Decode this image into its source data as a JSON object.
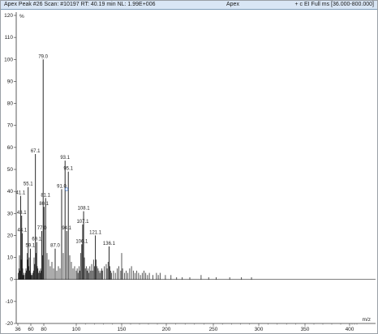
{
  "header": {
    "left_text": "Apex Peak #26 Scan: #10197  RT: 40.19 min NL: 1.99E+006",
    "center_text": "Apex",
    "right_text": "+ c EI Full ms [36.000-800.000]"
  },
  "chart_data": {
    "type": "bar",
    "title": "",
    "xlabel": "m/z",
    "ylabel": "%",
    "xlim": [
      36,
      440
    ],
    "ylim": [
      -20,
      120
    ],
    "x_ticks": [
      "36",
      "60",
      "80",
      "100",
      "150",
      "200",
      "250",
      "300",
      "350",
      "400"
    ],
    "y_ticks": [
      "-20",
      "-10",
      "0",
      "10",
      "20",
      "30",
      "40",
      "50",
      "60",
      "70",
      "80",
      "90",
      "100",
      "110",
      "120"
    ],
    "grid": false,
    "labeled_peaks": [
      {
        "mz": 41.1,
        "intensity": 38,
        "label": "41.1"
      },
      {
        "mz": 43.1,
        "intensity": 29,
        "label": "43.1"
      },
      {
        "mz": 44.1,
        "intensity": 21,
        "label": "44.1"
      },
      {
        "mz": 55.1,
        "intensity": 42,
        "label": "55.1"
      },
      {
        "mz": 59.1,
        "intensity": 14,
        "label": "59.1"
      },
      {
        "mz": 67.1,
        "intensity": 57,
        "label": "67.1"
      },
      {
        "mz": 69.1,
        "intensity": 17,
        "label": "69.1"
      },
      {
        "mz": 77.0,
        "intensity": 22,
        "label": "77.0"
      },
      {
        "mz": 79.0,
        "intensity": 100,
        "label": "79.0"
      },
      {
        "mz": 81.1,
        "intensity": 37,
        "label": "81.1"
      },
      {
        "mz": 80.1,
        "intensity": 33,
        "label": "80.1"
      },
      {
        "mz": 87.0,
        "intensity": 14,
        "label": "87.0"
      },
      {
        "mz": 91.0,
        "intensity": 41,
        "label": "91.0"
      },
      {
        "mz": 93.1,
        "intensity": 54,
        "label": "93.1"
      },
      {
        "mz": 95.1,
        "intensity": 49,
        "label": "95.1"
      },
      {
        "mz": 94.1,
        "intensity": 22,
        "label": "94.1"
      },
      {
        "mz": 106.1,
        "intensity": 16,
        "label": "106.1"
      },
      {
        "mz": 107.1,
        "intensity": 25,
        "label": "107.1"
      },
      {
        "mz": 108.1,
        "intensity": 31,
        "label": "108.1"
      },
      {
        "mz": 121.1,
        "intensity": 20,
        "label": "121.1"
      },
      {
        "mz": 136.1,
        "intensity": 15,
        "label": "136.1"
      }
    ],
    "minor_peaks": [
      {
        "mz": 37,
        "intensity": 3
      },
      {
        "mz": 38,
        "intensity": 5
      },
      {
        "mz": 39,
        "intensity": 11
      },
      {
        "mz": 40,
        "intensity": 4
      },
      {
        "mz": 42,
        "intensity": 9
      },
      {
        "mz": 45,
        "intensity": 5
      },
      {
        "mz": 46,
        "intensity": 2
      },
      {
        "mz": 47,
        "intensity": 3
      },
      {
        "mz": 48,
        "intensity": 2
      },
      {
        "mz": 50,
        "intensity": 3
      },
      {
        "mz": 51,
        "intensity": 5
      },
      {
        "mz": 52,
        "intensity": 4
      },
      {
        "mz": 53,
        "intensity": 12
      },
      {
        "mz": 54,
        "intensity": 9
      },
      {
        "mz": 56,
        "intensity": 6
      },
      {
        "mz": 57,
        "intensity": 10
      },
      {
        "mz": 58,
        "intensity": 4
      },
      {
        "mz": 60,
        "intensity": 3
      },
      {
        "mz": 61,
        "intensity": 2
      },
      {
        "mz": 62,
        "intensity": 2
      },
      {
        "mz": 63,
        "intensity": 3
      },
      {
        "mz": 64,
        "intensity": 4
      },
      {
        "mz": 65,
        "intensity": 10
      },
      {
        "mz": 66,
        "intensity": 7
      },
      {
        "mz": 68,
        "intensity": 12
      },
      {
        "mz": 70,
        "intensity": 6
      },
      {
        "mz": 71,
        "intensity": 5
      },
      {
        "mz": 72,
        "intensity": 3
      },
      {
        "mz": 73,
        "intensity": 4
      },
      {
        "mz": 74,
        "intensity": 3
      },
      {
        "mz": 75,
        "intensity": 5
      },
      {
        "mz": 76,
        "intensity": 4
      },
      {
        "mz": 78,
        "intensity": 11
      },
      {
        "mz": 82,
        "intensity": 12
      },
      {
        "mz": 83,
        "intensity": 9
      },
      {
        "mz": 84,
        "intensity": 6
      },
      {
        "mz": 85,
        "intensity": 8
      },
      {
        "mz": 86,
        "intensity": 5
      },
      {
        "mz": 88,
        "intensity": 4
      },
      {
        "mz": 89,
        "intensity": 6
      },
      {
        "mz": 90,
        "intensity": 5
      },
      {
        "mz": 92,
        "intensity": 12
      },
      {
        "mz": 96,
        "intensity": 11
      },
      {
        "mz": 97,
        "intensity": 8
      },
      {
        "mz": 98,
        "intensity": 5
      },
      {
        "mz": 99,
        "intensity": 6
      },
      {
        "mz": 100,
        "intensity": 4
      },
      {
        "mz": 101,
        "intensity": 5
      },
      {
        "mz": 102,
        "intensity": 3
      },
      {
        "mz": 103,
        "intensity": 6
      },
      {
        "mz": 104,
        "intensity": 4
      },
      {
        "mz": 105,
        "intensity": 12
      },
      {
        "mz": 109,
        "intensity": 10
      },
      {
        "mz": 110,
        "intensity": 5
      },
      {
        "mz": 111,
        "intensity": 6
      },
      {
        "mz": 112,
        "intensity": 4
      },
      {
        "mz": 113,
        "intensity": 5
      },
      {
        "mz": 114,
        "intensity": 3
      },
      {
        "mz": 115,
        "intensity": 6
      },
      {
        "mz": 116,
        "intensity": 4
      },
      {
        "mz": 117,
        "intensity": 7
      },
      {
        "mz": 118,
        "intensity": 4
      },
      {
        "mz": 119,
        "intensity": 9
      },
      {
        "mz": 120,
        "intensity": 6
      },
      {
        "mz": 122,
        "intensity": 9
      },
      {
        "mz": 123,
        "intensity": 6
      },
      {
        "mz": 124,
        "intensity": 5
      },
      {
        "mz": 125,
        "intensity": 4
      },
      {
        "mz": 126,
        "intensity": 3
      },
      {
        "mz": 127,
        "intensity": 4
      },
      {
        "mz": 128,
        "intensity": 5
      },
      {
        "mz": 129,
        "intensity": 4
      },
      {
        "mz": 131,
        "intensity": 6
      },
      {
        "mz": 133,
        "intensity": 7
      },
      {
        "mz": 134,
        "intensity": 5
      },
      {
        "mz": 135,
        "intensity": 8
      },
      {
        "mz": 137,
        "intensity": 6
      },
      {
        "mz": 138,
        "intensity": 4
      },
      {
        "mz": 139,
        "intensity": 3
      },
      {
        "mz": 141,
        "intensity": 4
      },
      {
        "mz": 143,
        "intensity": 3
      },
      {
        "mz": 145,
        "intensity": 5
      },
      {
        "mz": 147,
        "intensity": 6
      },
      {
        "mz": 149,
        "intensity": 4
      },
      {
        "mz": 150,
        "intensity": 12
      },
      {
        "mz": 151,
        "intensity": 5
      },
      {
        "mz": 153,
        "intensity": 3
      },
      {
        "mz": 155,
        "intensity": 4
      },
      {
        "mz": 157,
        "intensity": 3
      },
      {
        "mz": 159,
        "intensity": 5
      },
      {
        "mz": 161,
        "intensity": 6
      },
      {
        "mz": 163,
        "intensity": 4
      },
      {
        "mz": 165,
        "intensity": 3
      },
      {
        "mz": 167,
        "intensity": 4
      },
      {
        "mz": 169,
        "intensity": 3
      },
      {
        "mz": 171,
        "intensity": 2
      },
      {
        "mz": 173,
        "intensity": 3
      },
      {
        "mz": 175,
        "intensity": 4
      },
      {
        "mz": 177,
        "intensity": 3
      },
      {
        "mz": 179,
        "intensity": 2
      },
      {
        "mz": 181,
        "intensity": 3
      },
      {
        "mz": 185,
        "intensity": 2
      },
      {
        "mz": 189,
        "intensity": 3
      },
      {
        "mz": 191,
        "intensity": 2
      },
      {
        "mz": 193,
        "intensity": 3
      },
      {
        "mz": 199,
        "intensity": 2
      },
      {
        "mz": 205,
        "intensity": 2
      },
      {
        "mz": 211,
        "intensity": 1
      },
      {
        "mz": 217,
        "intensity": 1
      },
      {
        "mz": 225,
        "intensity": 1
      },
      {
        "mz": 237,
        "intensity": 2
      },
      {
        "mz": 245,
        "intensity": 1
      },
      {
        "mz": 253,
        "intensity": 1
      },
      {
        "mz": 268,
        "intensity": 1
      },
      {
        "mz": 281,
        "intensity": 1
      },
      {
        "mz": 292,
        "intensity": 1
      }
    ]
  },
  "colors": {
    "peak": "#111111",
    "axis": "#333333",
    "title_bar": "#d9e6f5",
    "marker": "#4a7cc9"
  }
}
